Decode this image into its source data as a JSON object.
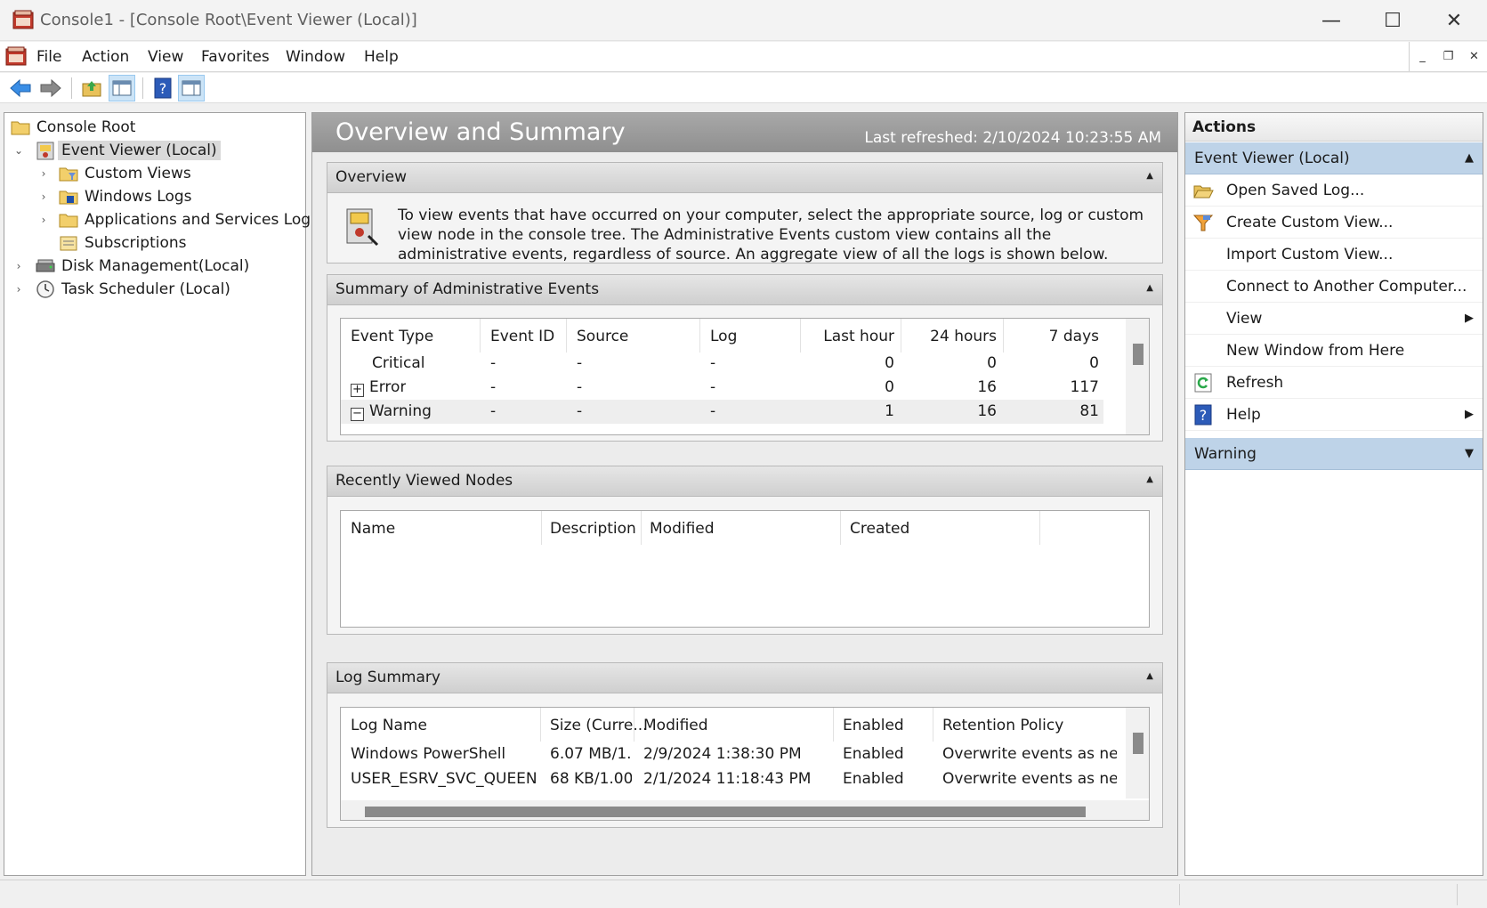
{
  "window": {
    "title": "Console1 - [Console Root\\Event Viewer (Local)]",
    "minimize": "—",
    "maximize": "☐",
    "close": "✕"
  },
  "menu": [
    "File",
    "Action",
    "View",
    "Favorites",
    "Window",
    "Help"
  ],
  "mdi": {
    "minimize": "_",
    "restore": "❐",
    "close": "✕"
  },
  "tree": {
    "root": "Console Root",
    "event_viewer": "Event Viewer (Local)",
    "custom_views": "Custom Views",
    "windows_logs": "Windows Logs",
    "app_services_logs": "Applications and Services Logs",
    "subscriptions": "Subscriptions",
    "disk_management": "Disk Management(Local)",
    "task_scheduler": "Task Scheduler (Local)"
  },
  "center": {
    "title": "Overview and Summary",
    "last_refreshed": "Last refreshed: 2/10/2024 10:23:55 AM",
    "overview": {
      "title": "Overview",
      "text": "To view events that have occurred on your computer, select the appropriate source, log or custom view node in the console tree. The Administrative Events custom view contains all the administrative events, regardless of source. An aggregate view of all the logs is shown below."
    },
    "summary": {
      "title": "Summary of Administrative Events",
      "headers": [
        "Event Type",
        "Event ID",
        "Source",
        "Log",
        "Last hour",
        "24 hours",
        "7 days"
      ],
      "rows": [
        {
          "type": "Critical",
          "expander": "",
          "event_id": "-",
          "source": "-",
          "log": "-",
          "last_hour": "0",
          "h24": "0",
          "d7": "0"
        },
        {
          "type": "Error",
          "expander": "+",
          "event_id": "-",
          "source": "-",
          "log": "-",
          "last_hour": "0",
          "h24": "16",
          "d7": "117"
        },
        {
          "type": "Warning",
          "expander": "−",
          "event_id": "-",
          "source": "-",
          "log": "-",
          "last_hour": "1",
          "h24": "16",
          "d7": "81"
        }
      ]
    },
    "recent": {
      "title": "Recently Viewed Nodes",
      "headers": [
        "Name",
        "Description",
        "Modified",
        "Created"
      ]
    },
    "log_summary": {
      "title": "Log Summary",
      "headers": [
        "Log Name",
        "Size (Curre...",
        "Modified",
        "Enabled",
        "Retention Policy"
      ],
      "rows": [
        {
          "name": "Windows PowerShell",
          "size": "6.07 MB/1...",
          "modified": "2/9/2024 1:38:30 PM",
          "enabled": "Enabled",
          "retention": "Overwrite events as nece..."
        },
        {
          "name": "USER_ESRV_SVC_QUEENC...",
          "size": "68 KB/1.00...",
          "modified": "2/1/2024 11:18:43 PM",
          "enabled": "Enabled",
          "retention": "Overwrite events as nece..."
        }
      ]
    }
  },
  "actions": {
    "header": "Actions",
    "group1": "Event Viewer (Local)",
    "items": [
      "Open Saved Log...",
      "Create Custom View...",
      "Import Custom View...",
      "Connect to Another Computer...",
      "View",
      "New Window from Here",
      "Refresh",
      "Help"
    ],
    "group2": "Warning"
  },
  "colors": {
    "accent_selected": "#bed3e8",
    "header_gray": "#9a9a9a"
  }
}
